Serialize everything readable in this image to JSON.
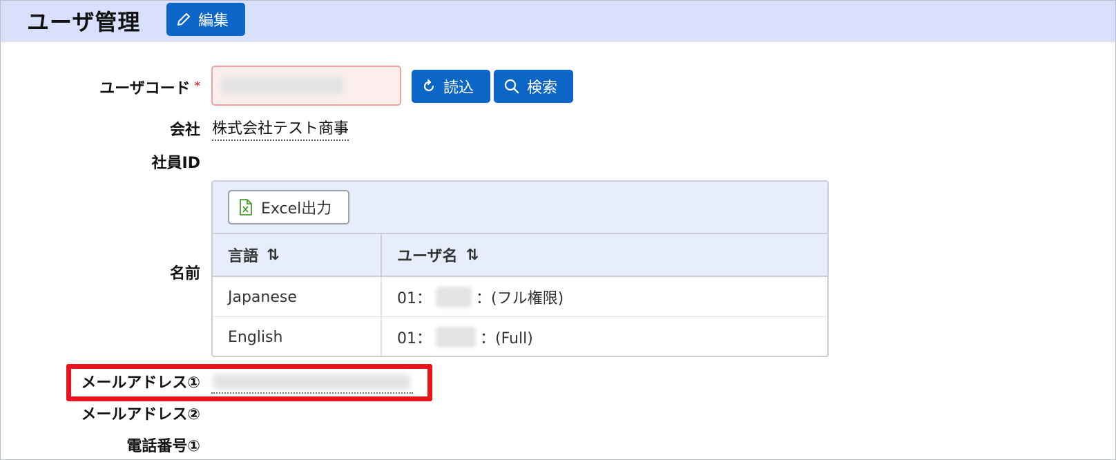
{
  "header": {
    "title": "ユーザ管理",
    "edit_label": "編集"
  },
  "form": {
    "user_code": {
      "label": "ユーザコード",
      "required_mark": "*",
      "value": ""
    },
    "read_button": "読込",
    "search_button": "検索",
    "company": {
      "label": "会社",
      "value": "株式会社テスト商事"
    },
    "employee_id": {
      "label": "社員ID"
    },
    "name": {
      "label": "名前"
    },
    "email1": {
      "label": "メールアドレス①"
    },
    "email2": {
      "label": "メールアドレス②"
    },
    "phone1": {
      "label": "電話番号①"
    }
  },
  "name_table": {
    "export_label": "Excel出力",
    "columns": [
      "言語",
      "ユーザ名"
    ],
    "sort_glyph": "⇅",
    "rows": [
      {
        "language": "Japanese",
        "prefix": "01：",
        "suffix": "：(フル権限)"
      },
      {
        "language": "English",
        "prefix": "01：",
        "suffix": "：(Full)"
      }
    ]
  },
  "colors": {
    "header_bg": "#d8e0fb",
    "primary": "#0b66c8",
    "required_bg": "#fdeeee",
    "highlight": "#e8131b"
  },
  "icons": {
    "edit": "pencil-icon",
    "read": "reload-icon",
    "search": "search-icon",
    "export": "excel-file-icon",
    "sort": "sort-icon"
  }
}
